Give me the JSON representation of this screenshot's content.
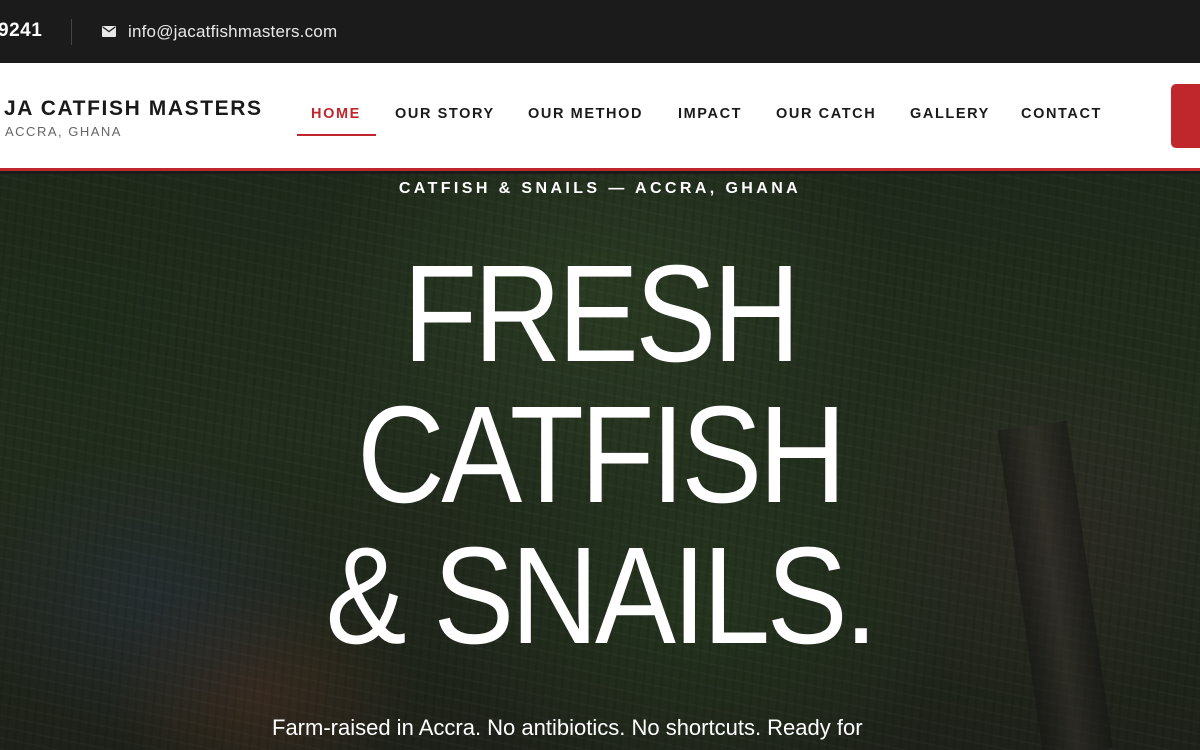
{
  "topbar": {
    "phone": "9241",
    "email_icon": "mail-icon",
    "email": "info@jacatfishmasters.com"
  },
  "brand": {
    "name": "JA CATFISH MASTERS",
    "location": "ACCRA, GHANA"
  },
  "nav": {
    "items": [
      {
        "label": "HOME",
        "active": true
      },
      {
        "label": "OUR STORY",
        "active": false
      },
      {
        "label": "OUR METHOD",
        "active": false
      },
      {
        "label": "IMPACT",
        "active": false
      },
      {
        "label": "OUR CATCH",
        "active": false
      },
      {
        "label": "GALLERY",
        "active": false
      },
      {
        "label": "CONTACT",
        "active": false
      }
    ]
  },
  "hero": {
    "eyebrow": "CATFISH & SNAILS — ACCRA, GHANA",
    "headline": [
      "FRESH",
      "CATFISH",
      "& SNAILS."
    ],
    "tagline": "Farm-raised in Accra. No antibiotics. No shortcuts. Ready for"
  },
  "colors": {
    "accent": "#c0272d",
    "topbar_bg": "#1b1b1b",
    "header_bg": "#ffffff"
  }
}
